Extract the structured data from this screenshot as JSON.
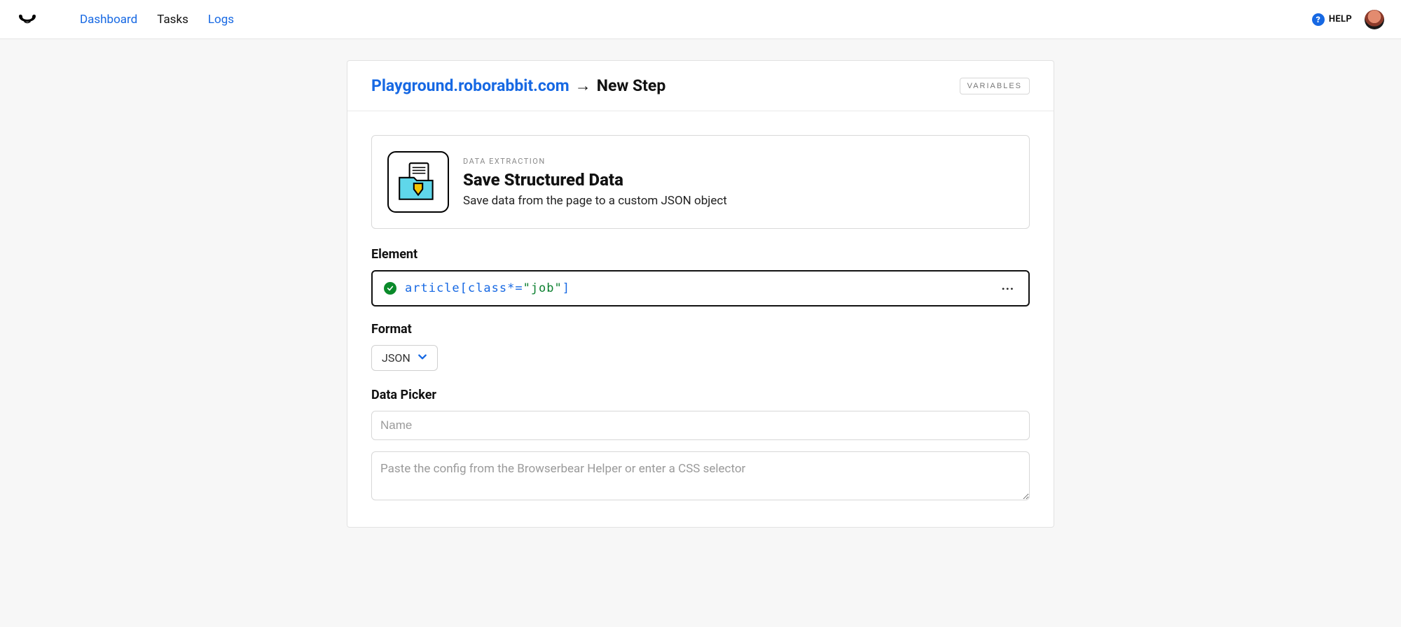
{
  "nav": {
    "dashboard": "Dashboard",
    "tasks": "Tasks",
    "logs": "Logs"
  },
  "help_label": "HELP",
  "breadcrumb": {
    "site": "Playground.roborabbit.com",
    "arrow": "→",
    "current": "New Step"
  },
  "variables_btn": "VARIABLES",
  "step": {
    "category": "DATA EXTRACTION",
    "title": "Save Structured Data",
    "description": "Save data from the page to a custom JSON object"
  },
  "labels": {
    "element": "Element",
    "format": "Format",
    "data_picker": "Data Picker"
  },
  "element_selector": {
    "raw": "article[class*=\"job\"]",
    "tokens": {
      "tag": "article",
      "open_bracket": "[",
      "attr": "class*=",
      "quote_open": "\"",
      "value": "job",
      "quote_close": "\"",
      "close_bracket": "]"
    },
    "valid": true
  },
  "format_select": {
    "value": "JSON"
  },
  "data_picker": {
    "name_placeholder": "Name",
    "name_value": "",
    "config_placeholder": "Paste the config from the Browserbear Helper or enter a CSS selector",
    "config_value": ""
  }
}
